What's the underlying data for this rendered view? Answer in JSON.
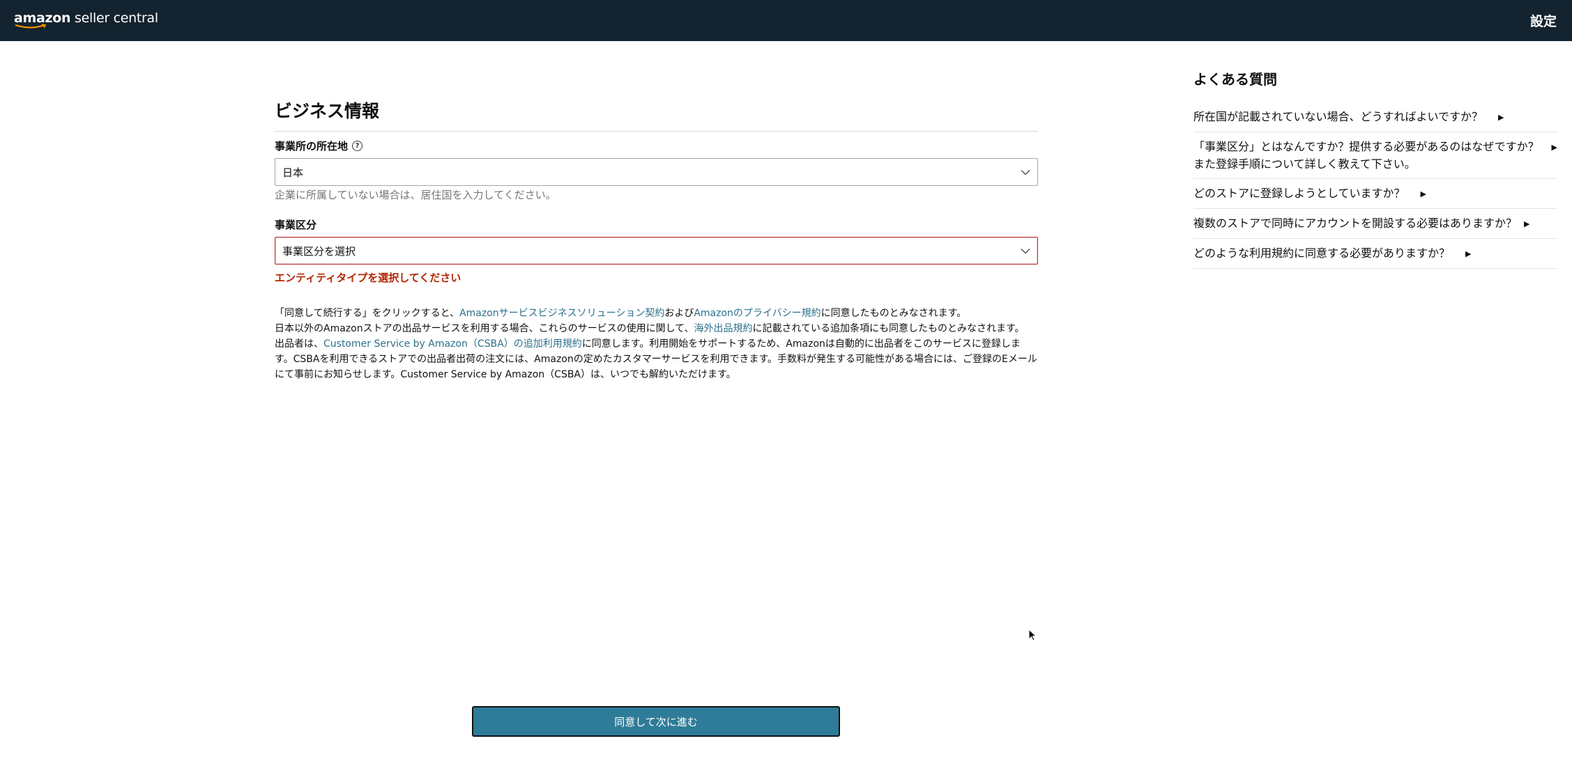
{
  "header": {
    "logo_prefix": "amazon",
    "logo_suffix": " seller central",
    "settings_label": "設定"
  },
  "form": {
    "title": "ビジネス情報",
    "location": {
      "label": "事業所の所在地",
      "help_icon": "question-circle-icon",
      "value": "日本",
      "hint": "企業に所属していない場合は、居住国を入力してください。"
    },
    "entity": {
      "label": "事業区分",
      "value": "事業区分を選択",
      "error": "エンティティタイプを選択してください"
    }
  },
  "legal": {
    "p1_a": "「同意して続行する」をクリックすると、",
    "p1_link1": "Amazonサービスビジネスソリューション契約",
    "p1_b": "および",
    "p1_link2": "Amazonのプライバシー規約",
    "p1_c": "に同意したものとみなされます。",
    "p2_a": "日本以外のAmazonストアの出品サービスを利用する場合、これらのサービスの使用に関して、",
    "p2_link": "海外出品規約",
    "p2_b": "に記載されている追加条項にも同意したものとみなされます。",
    "p3_a": "出品者は、",
    "p3_link": "Customer Service by Amazon（CSBA）の追加利用規約",
    "p3_b": "に同意します。利用開始をサポートするため、Amazonは自動的に出品者をこのサービスに登録します。CSBAを利用できるストアでの出品者出荷の注文には、Amazonの定めたカスタマーサービスを利用できます。手数料が発生する可能性がある場合には、ご登録のEメールにて事前にお知らせします。Customer Service by Amazon（CSBA）は、いつでも解約いただけます。"
  },
  "submit_label": "同意して次に進む",
  "faq": {
    "title": "よくある質問",
    "items": [
      "所在国が記載されていない場合、どうすればよいですか？",
      "「事業区分」とはなんですか？提供する必要があるのはなぜですか？また登録手順について詳しく教えて下さい。",
      "どのストアに登録しようとしていますか？",
      "複数のストアで同時にアカウントを開設する必要はありますか？",
      "どのような利用規約に同意する必要がありますか？"
    ],
    "arrow": "▶"
  },
  "colors": {
    "header_bg": "#13232f",
    "link": "#2d6f8c",
    "error": "#b12704",
    "button_bg": "#2f7c98"
  }
}
